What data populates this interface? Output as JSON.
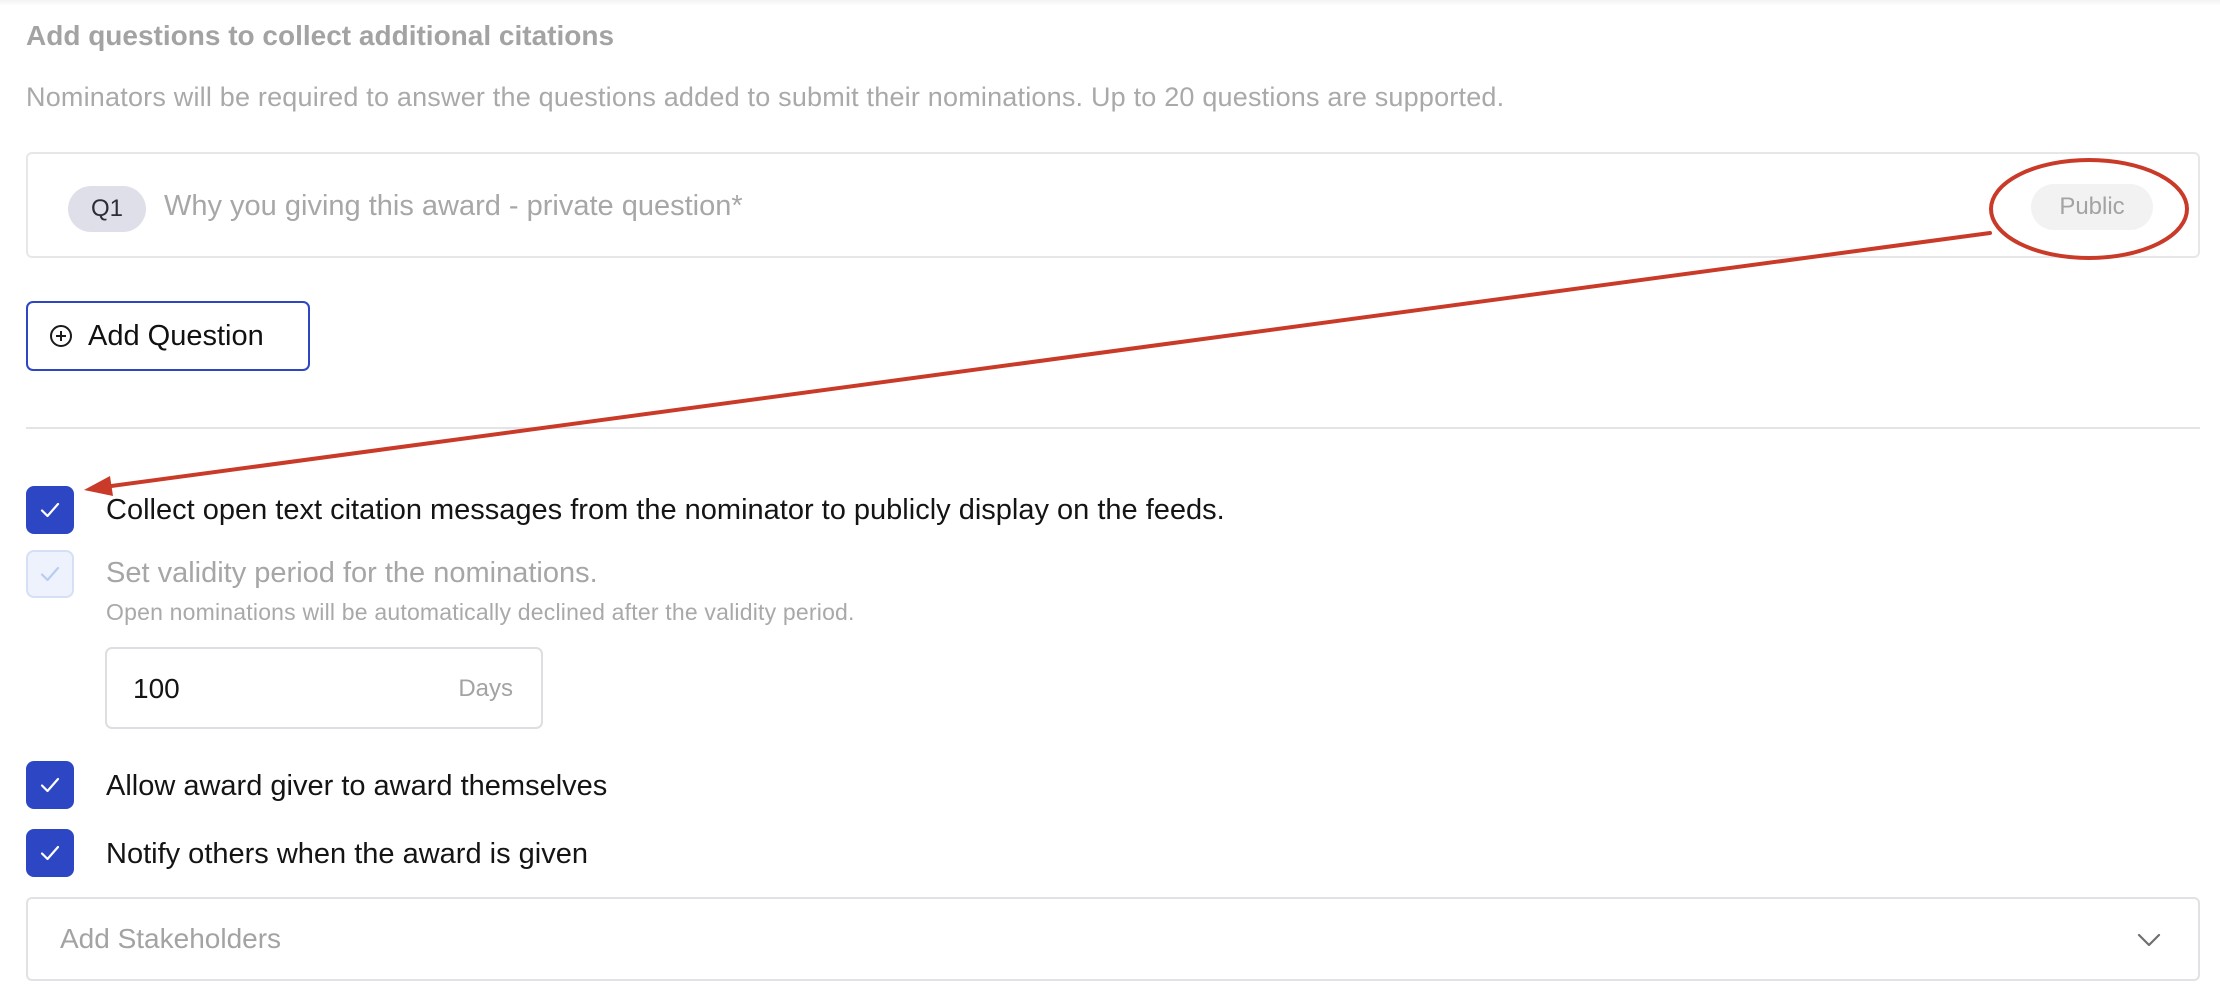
{
  "citations": {
    "title": "Add questions to collect additional citations",
    "description": "Nominators will be required to answer the questions added to submit their nominations. Up to 20 questions are supported.",
    "questions": [
      {
        "badge": "Q1",
        "text": "Why you giving this award - private question*",
        "visibility": "Public"
      }
    ],
    "add_question_label": "Add Question"
  },
  "options": {
    "collect_citations": {
      "label": "Collect open text citation messages from the nominator to publicly display on the feeds.",
      "checked": true
    },
    "validity_period": {
      "label": "Set validity period for the nominations.",
      "helper": "Open nominations will be automatically declined after the validity period.",
      "checked": true,
      "disabled": true,
      "value": "100",
      "unit": "Days"
    },
    "self_award": {
      "label": "Allow award giver to award themselves",
      "checked": true
    },
    "notify_others": {
      "label": "Notify others when the award is given",
      "checked": true
    }
  },
  "stakeholders": {
    "placeholder": "Add Stakeholders"
  },
  "colors": {
    "accent": "#2d46c4",
    "annotation": "#c93a28",
    "muted_text": "#a6a6a6"
  },
  "icons": {
    "add_question": "plus-circle-icon",
    "checkbox": "checkmark-icon",
    "dropdown": "chevron-down-icon"
  }
}
